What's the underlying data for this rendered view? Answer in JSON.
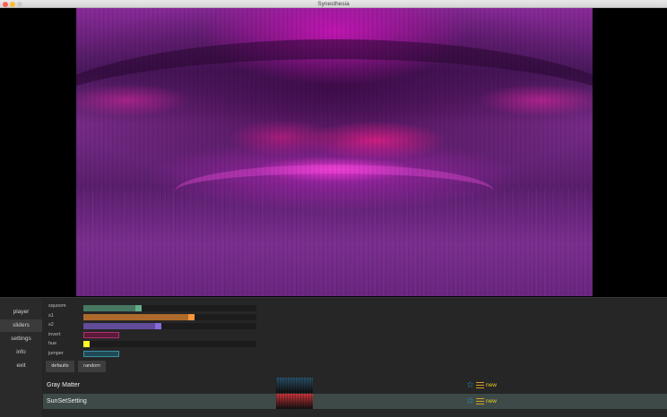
{
  "window": {
    "title": "Synesthesia"
  },
  "sidebar": {
    "items": [
      {
        "label": "player"
      },
      {
        "label": "sliders"
      },
      {
        "label": "settings"
      },
      {
        "label": "info"
      },
      {
        "label": "exit"
      }
    ],
    "active": "sliders"
  },
  "controls": {
    "sliders": [
      {
        "label": "squoom",
        "value": 0.31,
        "color": "#4f8a6e"
      },
      {
        "label": "s1",
        "value": 0.63,
        "color": "#c8782e"
      },
      {
        "label": "s2",
        "value": 0.43,
        "color": "#6d55b0"
      },
      {
        "label": "invert",
        "value": 0,
        "color": "#b0306e",
        "kind": "toggle"
      },
      {
        "label": "hue",
        "value": 0.0,
        "color": "#f0d020"
      },
      {
        "label": "jumper",
        "value": 0,
        "color": "#3a8fa0",
        "kind": "toggle"
      }
    ],
    "buttons": {
      "defaults": "defaults",
      "random": "random"
    }
  },
  "scenes": [
    {
      "name": "Gray Matter",
      "badge": "new",
      "selected": false,
      "thumb_color": "#2a4f66"
    },
    {
      "name": "SunSetSetting",
      "badge": "new",
      "selected": true,
      "thumb_color": "#c8343a"
    }
  ],
  "icons": {
    "favorite": "star-outline-icon",
    "menu": "menu-lines-icon"
  },
  "colors": {
    "panel": "#262626",
    "selected_row": "#3d4a48",
    "accent_star": "#2fa7b8",
    "badge": "#e8d020"
  }
}
